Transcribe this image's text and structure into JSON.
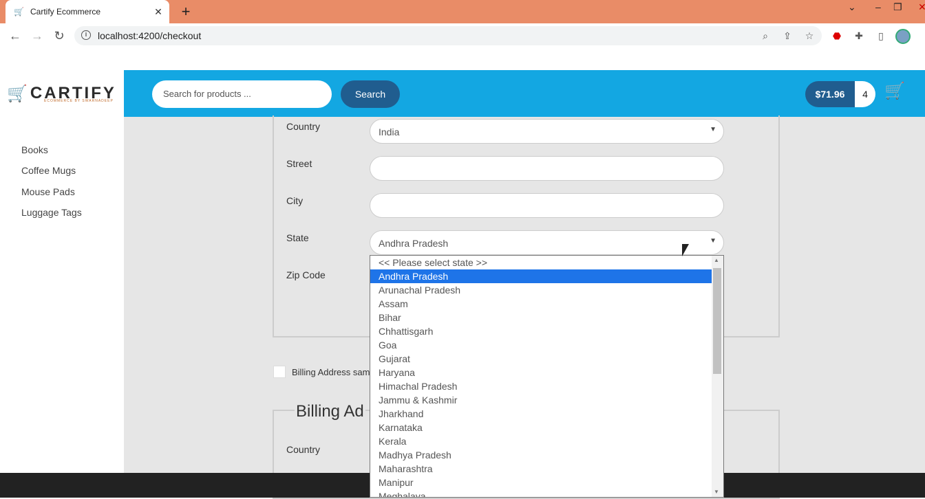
{
  "browser": {
    "tab_title": "Cartify Ecommerce",
    "url": "localhost:4200/checkout"
  },
  "brand": {
    "name": "CARTIFY",
    "tagline": "ECOMMERCE BY SWARNADEEP"
  },
  "header": {
    "search_placeholder": "Search for products ...",
    "search_button": "Search",
    "cart_total": "$71.96",
    "cart_quantity": "4"
  },
  "sidebar": {
    "items": [
      {
        "label": "Books"
      },
      {
        "label": "Coffee Mugs"
      },
      {
        "label": "Mouse Pads"
      },
      {
        "label": "Luggage Tags"
      }
    ]
  },
  "shipping": {
    "country_label": "Country",
    "country_value": "India",
    "street_label": "Street",
    "city_label": "City",
    "state_label": "State",
    "state_value": "Andhra Pradesh",
    "zip_label": "Zip Code"
  },
  "billing_same_label": "Billing Address same",
  "billing": {
    "title": "Billing Ad",
    "country_label": "Country"
  },
  "state_dropdown": {
    "selected": "Andhra Pradesh",
    "options": [
      "<< Please select state >>",
      "Andhra Pradesh",
      "Arunachal Pradesh",
      "Assam",
      "Bihar",
      "Chhattisgarh",
      "Goa",
      "Gujarat",
      "Haryana",
      "Himachal Pradesh",
      "Jammu & Kashmir",
      "Jharkhand",
      "Karnataka",
      "Kerala",
      "Madhya Pradesh",
      "Maharashtra",
      "Manipur",
      "Meghalaya"
    ]
  },
  "colors": {
    "header": "#13a7e2",
    "button": "#205d8f",
    "selected_option": "#1e74e8"
  }
}
